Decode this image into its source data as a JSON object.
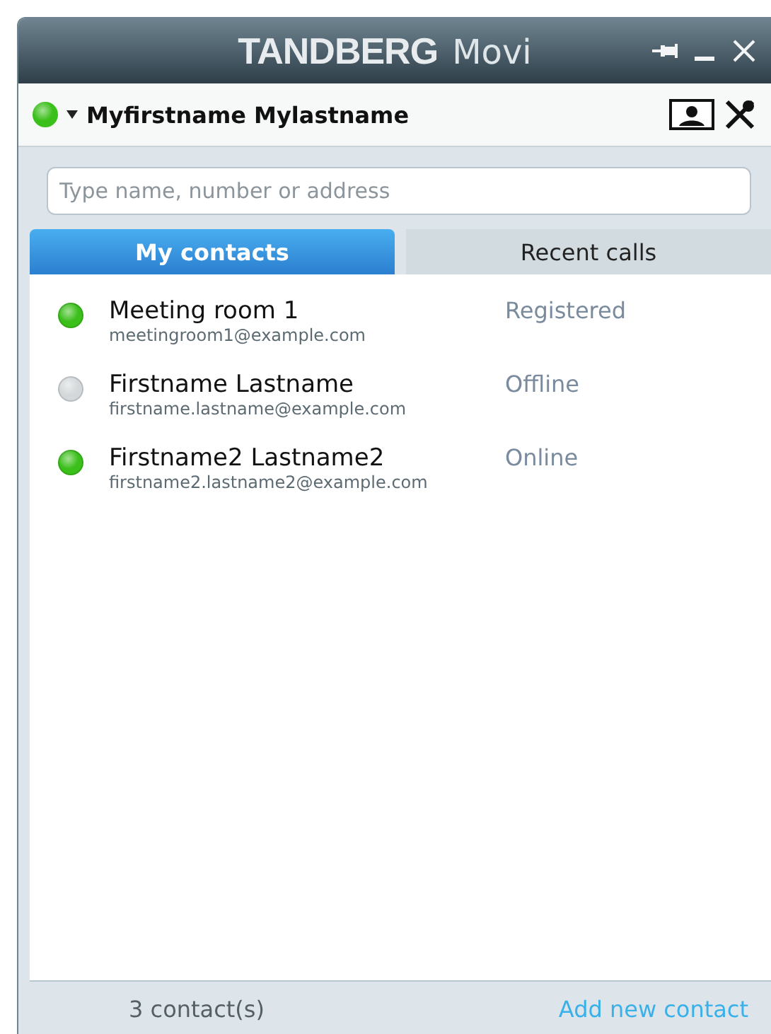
{
  "window": {
    "brand": "TANDBERG",
    "product": "Movi"
  },
  "user": {
    "name": "Myfirstname Mylastname",
    "color": "#3bbf1a"
  },
  "search": {
    "placeholder": "Type name, number or address"
  },
  "tabs": [
    {
      "label": "My contacts",
      "selected": true
    },
    {
      "label": "Recent calls",
      "selected": false
    }
  ],
  "contacts": [
    {
      "name": "Meeting room 1",
      "address": "meetingroom1@example.com",
      "status": "Registered",
      "color": "#3bbf1a"
    },
    {
      "name": "Firstname Lastname",
      "address": "firstname.lastname@example.com",
      "status": "Offline",
      "color": "#d4d8da"
    },
    {
      "name": "Firstname2 Lastname2",
      "address": "firstname2.lastname2@example.com",
      "status": "Online",
      "color": "#3bbf1a"
    }
  ],
  "status_bar": {
    "count": "3 contact(s)",
    "link": "Add new contact"
  }
}
